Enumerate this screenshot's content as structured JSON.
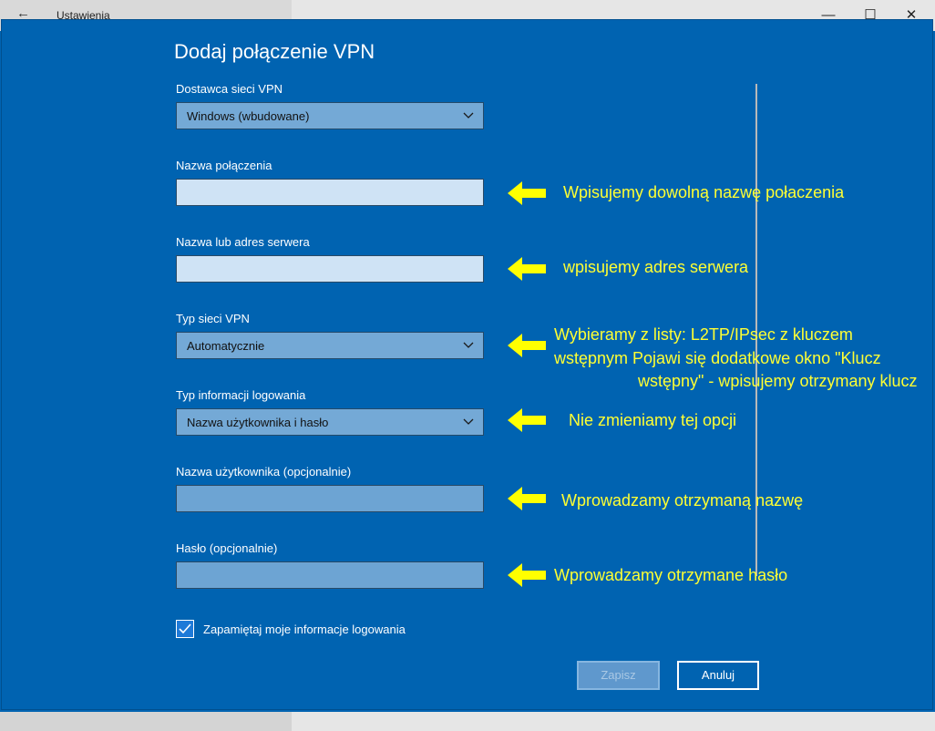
{
  "window": {
    "back_glyph": "←",
    "title": "Ustawienia",
    "minimize_glyph": "—",
    "maximize_glyph": "☐",
    "close_glyph": "✕"
  },
  "dialog": {
    "title": "Dodaj połączenie VPN",
    "provider": {
      "label": "Dostawca sieci VPN",
      "value": "Windows (wbudowane)"
    },
    "connection_name": {
      "label": "Nazwa połączenia",
      "value": ""
    },
    "server": {
      "label": "Nazwa lub adres serwera",
      "value": ""
    },
    "vpn_type": {
      "label": "Typ sieci VPN",
      "value": "Automatycznie"
    },
    "signin_type": {
      "label": "Typ informacji logowania",
      "value": "Nazwa użytkownika i hasło"
    },
    "username": {
      "label": "Nazwa użytkownika (opcjonalnie)",
      "value": ""
    },
    "password": {
      "label": "Hasło (opcjonalnie)",
      "value": ""
    },
    "remember": {
      "label": "Zapamiętaj moje informacje logowania",
      "checked": true
    },
    "save_label": "Zapisz",
    "cancel_label": "Anuluj"
  },
  "annotations": {
    "connection_name": "Wpisujemy dowolną nazwę połaczenia",
    "server": "wpisujemy adres serwera",
    "vpn_type_line1": "Wybieramy z listy: L2TP/IPsec z kluczem",
    "vpn_type_line2": "wstępnym  Pojawi się dodatkowe okno \"Klucz",
    "vpn_type_line3": "wstępny\" - wpisujemy otrzymany klucz",
    "signin_type": "Nie zmieniamy tej opcji",
    "username": "Wprowadzamy otrzymaną nazwę",
    "password": "Wprowadzamy otrzymane hasło"
  },
  "colors": {
    "dialog_bg": "#0063b1",
    "annotation_text": "#ffff33",
    "annotation_arrow": "#ffff00"
  }
}
